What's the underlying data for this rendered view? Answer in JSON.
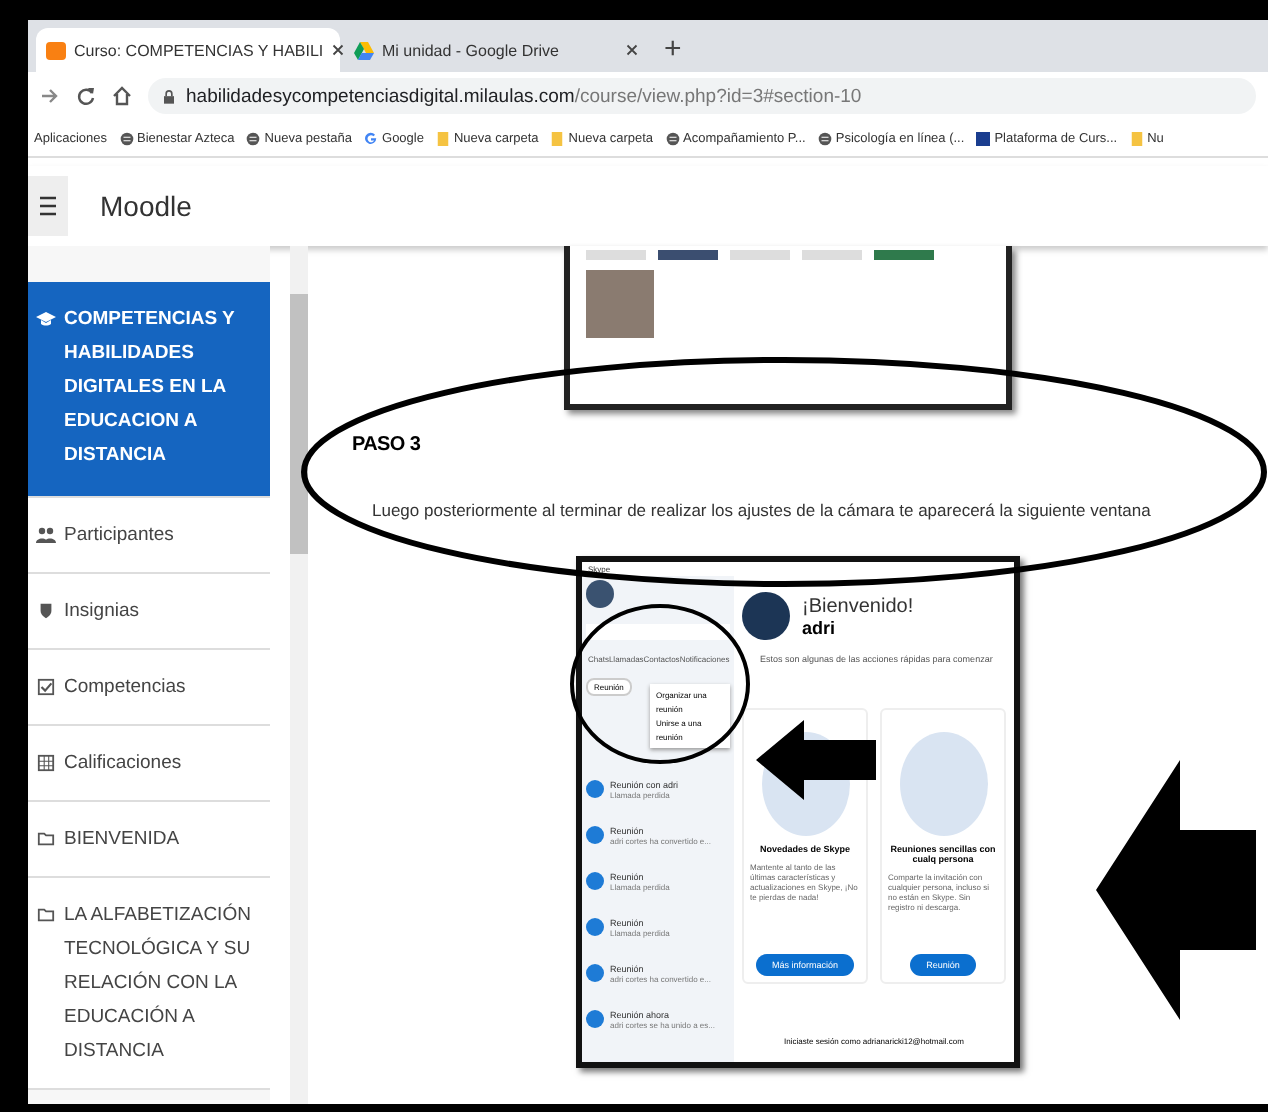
{
  "browser": {
    "tabs": [
      {
        "title": "Curso: COMPETENCIAS Y HABILI",
        "selected": true,
        "kind": "moodle"
      },
      {
        "title": "Mi unidad - Google Drive",
        "selected": false,
        "kind": "drive"
      }
    ],
    "new_tab": "+",
    "url_host": "habilidadesycompetenciasdigital.milaulas.com",
    "url_path": "/course/view.php?id=3#section-10",
    "bookmarks": [
      {
        "label": "Aplicaciones",
        "kind": "apps"
      },
      {
        "label": "Bienestar Azteca",
        "kind": "globe"
      },
      {
        "label": "Nueva pestaña",
        "kind": "globe"
      },
      {
        "label": "Google",
        "kind": "google"
      },
      {
        "label": "Nueva carpeta",
        "kind": "folder"
      },
      {
        "label": "Nueva carpeta",
        "kind": "folder"
      },
      {
        "label": "Acompañamiento P...",
        "kind": "globe"
      },
      {
        "label": "Psicología en línea (...",
        "kind": "globe"
      },
      {
        "label": "Plataforma de Curs...",
        "kind": "site"
      },
      {
        "label": "Nu",
        "kind": "folder"
      }
    ]
  },
  "header": {
    "site_name": "Moodle"
  },
  "sidebar": {
    "items": [
      {
        "label": "COMPETENCIAS Y HABILIDADES DIGITALES EN LA EDUCACION A DISTANCIA",
        "kind": "course",
        "selected": true
      },
      {
        "label": "Participantes",
        "kind": "people",
        "selected": false
      },
      {
        "label": "Insignias",
        "kind": "shield",
        "selected": false
      },
      {
        "label": "Competencias",
        "kind": "check",
        "selected": false
      },
      {
        "label": "Calificaciones",
        "kind": "table",
        "selected": false
      },
      {
        "label": "BIENVENIDA",
        "kind": "folder",
        "selected": false
      },
      {
        "label": "LA ALFABETIZACIÓN TECNOLÓGICA Y SU RELACIÓN CON LA EDUCACIÓN A DISTANCIA",
        "kind": "folder",
        "selected": false
      }
    ]
  },
  "content": {
    "heading": "PASO 3",
    "paragraph": "Luego posteriormente al terminar de realizar los  ajustes de la cámara te aparecerá  la  siguiente  ventana",
    "skype": {
      "title": "Skype",
      "welcome": "¡Bienvenido!",
      "user": "adri",
      "intro": "Estos son algunas de las acciones rápidas para comenzar",
      "nav": [
        "Chats",
        "Llamadas",
        "Contactos",
        "Notificaciones"
      ],
      "menu": [
        "Organizar una reunión",
        "Unirse a una reunión"
      ],
      "meet_button": "Reunión",
      "chats": [
        {
          "name": "Reunión con adri",
          "sub": "Llamada perdida"
        },
        {
          "name": "Reunión",
          "sub": "adri cortes ha convertido e..."
        },
        {
          "name": "Reunión",
          "sub": "Llamada perdida"
        },
        {
          "name": "Reunión",
          "sub": "Llamada perdida"
        },
        {
          "name": "Reunión",
          "sub": "adri cortes ha convertido e..."
        },
        {
          "name": "Reunión ahora",
          "sub": "adri cortes se ha unido a es..."
        }
      ],
      "cards": [
        {
          "title": "Novedades de Skype",
          "text": "Mantente al tanto de las últimas características y actualizaciones en Skype, ¡No te pierdas de nada!",
          "button": "Más información"
        },
        {
          "title": "Reuniones sencillas con cualq persona",
          "text": "Comparte la invitación con cualquier persona, incluso si no están en Skype. Sin registro ni descarga.",
          "button": "Reunión"
        }
      ],
      "footer": "Iniciaste sesión como adrianaricki12@hotmail.com"
    }
  }
}
